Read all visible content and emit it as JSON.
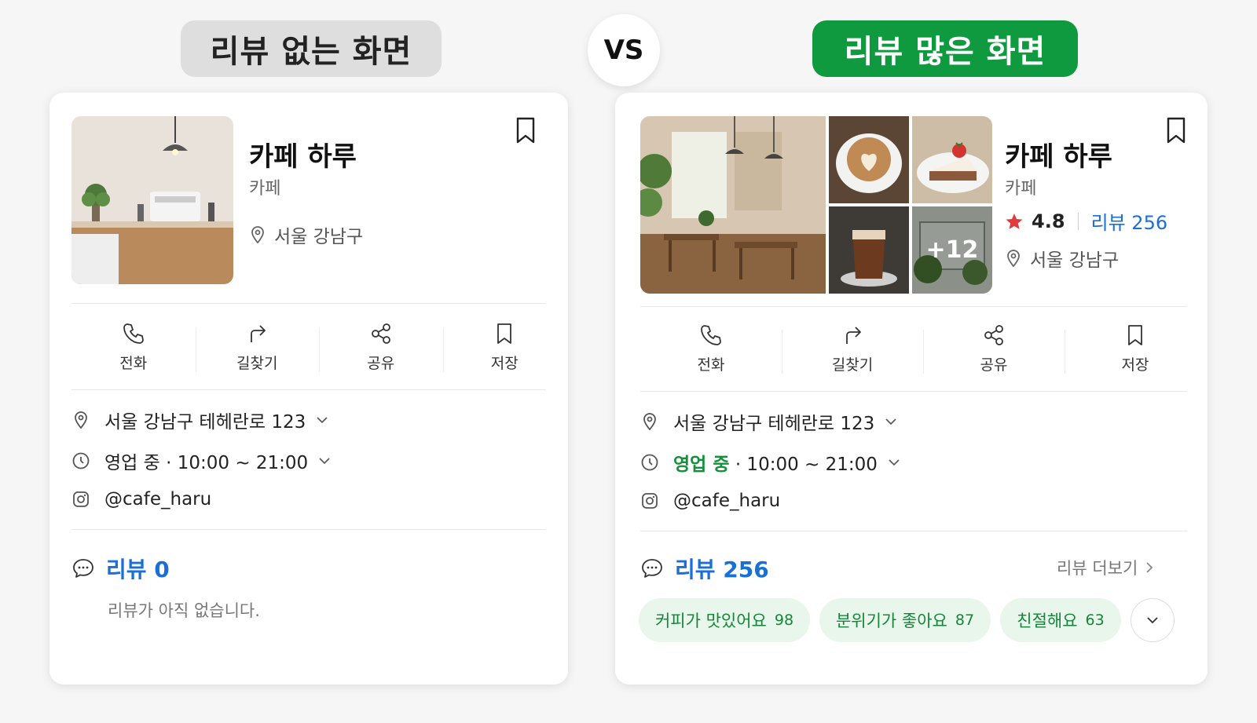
{
  "header": {
    "left_title": "리뷰 없는 화면",
    "vs": "VS",
    "right_title": "리뷰 많은 화면"
  },
  "left": {
    "name": "카페 하루",
    "category": "카페",
    "location": "서울 강남구",
    "actions": [
      "전화",
      "길찾기",
      "공유",
      "저장"
    ],
    "address": "서울 강남구 테헤란로 123",
    "hours_status": "영업 중",
    "hours_time": "· 10:00 ~ 21:00",
    "instagram": "@cafe_haru",
    "review_label": "리뷰 0",
    "review_empty": "리뷰가 아직 없습니다."
  },
  "right": {
    "name": "카페 하루",
    "category": "카페",
    "rating": "4.8",
    "rating_reviews": "리뷰 256",
    "location": "서울 강남구",
    "photo_more": "+12",
    "actions": [
      "전화",
      "길찾기",
      "공유",
      "저장"
    ],
    "address": "서울 강남구 테헤란로 123",
    "hours_status": "영업 중",
    "hours_time": "· 10:00 ~ 21:00",
    "instagram": "@cafe_haru",
    "review_label": "리뷰 256",
    "review_more": "리뷰 더보기",
    "chips": [
      {
        "label": "커피가 맛있어요",
        "count": "98"
      },
      {
        "label": "분위기가 좋아요",
        "count": "87"
      },
      {
        "label": "친절해요",
        "count": "63"
      }
    ]
  },
  "colors": {
    "accent_green": "#0f9a3f",
    "link_blue": "#1a6fd6",
    "star_red": "#e23b3b",
    "chip_bg": "#e9f6ec"
  }
}
